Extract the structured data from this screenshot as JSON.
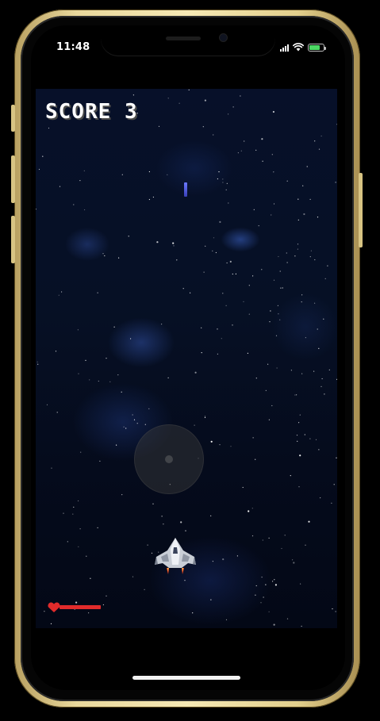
{
  "status_bar": {
    "time": "11:48",
    "icons": [
      "signal-icon",
      "wifi-icon",
      "battery-icon"
    ]
  },
  "game": {
    "score_label": "SCORE",
    "score_value": "3",
    "health_fraction": 1.0,
    "colors": {
      "background": "#050b1c",
      "laser": "#5560e8",
      "health": "#e22b2b",
      "frame_gold": "#e9d89c"
    }
  }
}
